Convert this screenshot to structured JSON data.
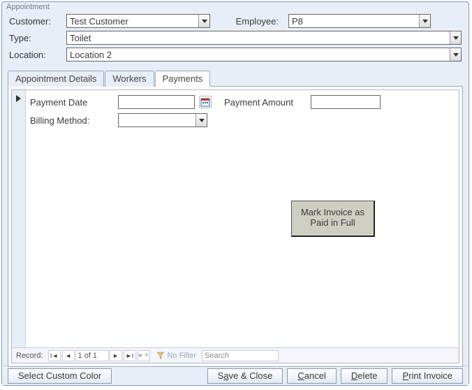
{
  "window_title": "Appointment",
  "header": {
    "customer_label": "Customer:",
    "customer_value": "Test Customer",
    "employee_label": "Employee:",
    "employee_value": "P8",
    "type_label": "Type:",
    "type_value": "Toilet",
    "location_label": "Location:",
    "location_value": "Location 2"
  },
  "tabs": [
    {
      "label": "Appointment Details",
      "active": false
    },
    {
      "label": "Workers",
      "active": false
    },
    {
      "label": "Payments",
      "active": true
    }
  ],
  "payments": {
    "payment_date_label": "Payment Date",
    "payment_date_value": "",
    "payment_amount_label": "Payment Amount",
    "payment_amount_value": "",
    "billing_method_label": "Billing Method:",
    "billing_method_value": "",
    "mark_paid_button": "Mark Invoice as Paid in Full"
  },
  "recnav": {
    "label": "Record:",
    "position": "1 of 1",
    "no_filter": "No Filter",
    "search_placeholder": "Search"
  },
  "footer": {
    "select_color": "Select Custom Color",
    "save_close_pre": "S",
    "save_close_u": "a",
    "save_close_post": "ve & Close",
    "cancel_u": "C",
    "cancel_post": "ancel",
    "delete_u": "D",
    "delete_post": "elete",
    "print_u": "P",
    "print_post": "rint Invoice"
  }
}
